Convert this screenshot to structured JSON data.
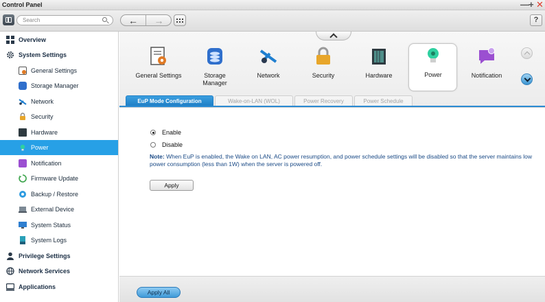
{
  "window": {
    "title": "Control Panel",
    "minimize_glyph": "—",
    "maximize_glyph": "+",
    "close_glyph": "✕"
  },
  "toolbar": {
    "search_placeholder": "Search",
    "back_glyph": "←",
    "forward_glyph": "→",
    "help_label": "?"
  },
  "sidebar": {
    "items": [
      {
        "label": "Overview",
        "level": "top",
        "icon": "overview-icon"
      },
      {
        "label": "System Settings",
        "level": "top",
        "icon": "gear-icon"
      },
      {
        "label": "General Settings",
        "level": "sub",
        "icon": "general-settings-icon"
      },
      {
        "label": "Storage Manager",
        "level": "sub",
        "icon": "storage-icon"
      },
      {
        "label": "Network",
        "level": "sub",
        "icon": "network-icon"
      },
      {
        "label": "Security",
        "level": "sub",
        "icon": "lock-icon"
      },
      {
        "label": "Hardware",
        "level": "sub",
        "icon": "hardware-icon"
      },
      {
        "label": "Power",
        "level": "sub",
        "icon": "bulb-icon",
        "active": true
      },
      {
        "label": "Notification",
        "level": "sub",
        "icon": "notification-icon"
      },
      {
        "label": "Firmware Update",
        "level": "sub",
        "icon": "firmware-icon"
      },
      {
        "label": "Backup / Restore",
        "level": "sub",
        "icon": "backup-icon"
      },
      {
        "label": "External Device",
        "level": "sub",
        "icon": "external-device-icon"
      },
      {
        "label": "System Status",
        "level": "sub",
        "icon": "monitor-icon"
      },
      {
        "label": "System Logs",
        "level": "sub",
        "icon": "logs-icon"
      },
      {
        "label": "Privilege Settings",
        "level": "top",
        "icon": "user-icon"
      },
      {
        "label": "Network Services",
        "level": "top",
        "icon": "globe-icon"
      },
      {
        "label": "Applications",
        "level": "top",
        "icon": "applications-icon"
      }
    ]
  },
  "apps": [
    {
      "label": "General Settings",
      "icon": "general-settings-icon"
    },
    {
      "label": "Storage Manager",
      "icon": "storage-icon"
    },
    {
      "label": "Network",
      "icon": "network-icon"
    },
    {
      "label": "Security",
      "icon": "lock-icon"
    },
    {
      "label": "Hardware",
      "icon": "hardware-icon"
    },
    {
      "label": "Power",
      "icon": "bulb-icon",
      "selected": true
    },
    {
      "label": "Notification",
      "icon": "notification-icon"
    }
  ],
  "tabs": [
    {
      "label": "EuP Mode Configuration",
      "active": true
    },
    {
      "label": "Wake-on-LAN (WOL)"
    },
    {
      "label": "Power Recovery"
    },
    {
      "label": "Power Schedule"
    }
  ],
  "eup": {
    "options": [
      {
        "label": "Enable",
        "selected": true
      },
      {
        "label": "Disable",
        "selected": false
      }
    ],
    "note_prefix": "Note:",
    "note_text": " When EuP is enabled, the Wake on LAN, AC power resumption, and power schedule settings will be disabled so that the server maintains low power consumption (less than 1W) when the server is powered off.",
    "apply_label": "Apply"
  },
  "footer": {
    "apply_all_label": "Apply All"
  },
  "colors": {
    "accent": "#27a0e6",
    "note_text": "#1a4a86",
    "tab_active": "#1f7fc6"
  }
}
